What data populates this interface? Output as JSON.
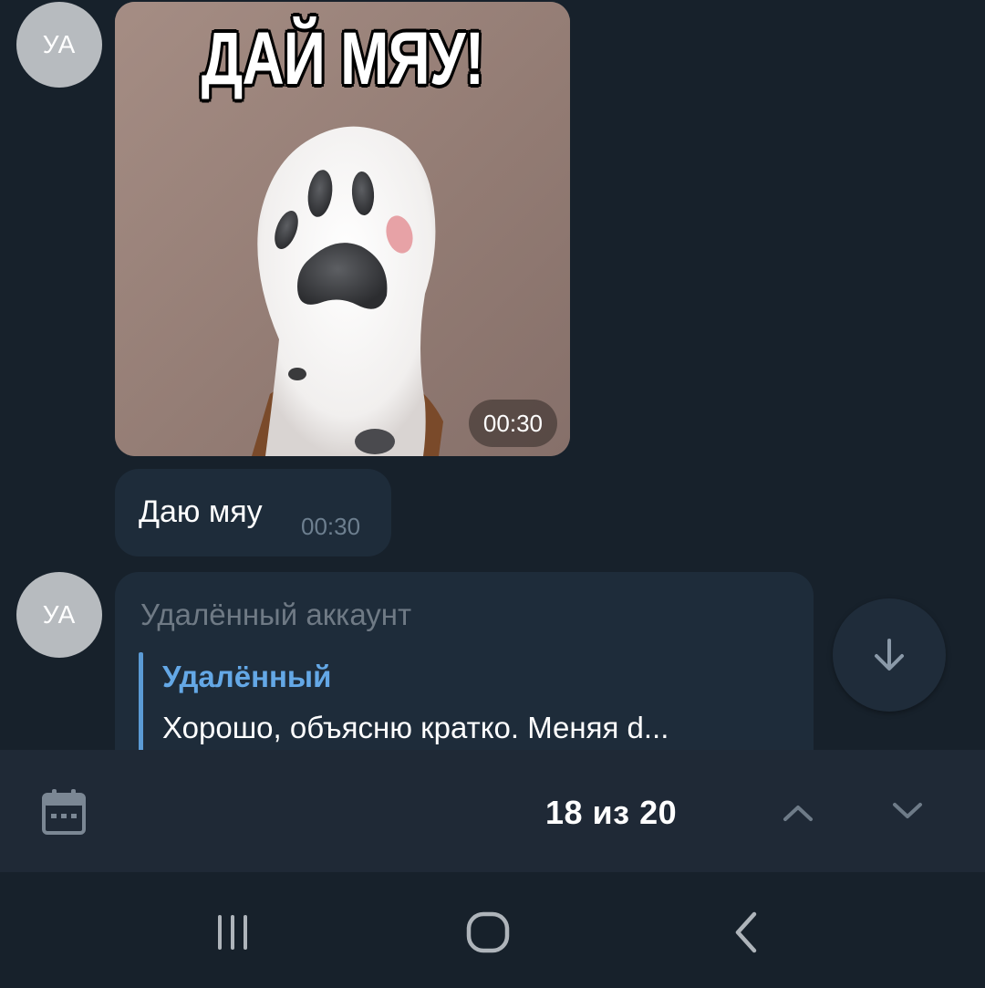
{
  "chat": {
    "messages": [
      {
        "type": "media",
        "avatar_initials": "УА",
        "image_text": "ДАЙ МЯУ!",
        "time": "00:30"
      },
      {
        "type": "text",
        "text": "Даю мяу",
        "time": "00:30"
      },
      {
        "type": "reply",
        "avatar_initials": "УА",
        "sender": "Удалённый аккаунт",
        "quote_author": "Удалённый",
        "quote_text": "Хорошо, объясню кратко. Меняя d..."
      }
    ],
    "scroll_down_icon": "arrow-down-icon"
  },
  "search_nav": {
    "calendar_icon": "calendar-icon",
    "counter": "18 из 20",
    "up_icon": "chevron-up-icon",
    "down_icon": "chevron-down-icon"
  },
  "system_nav": {
    "recents_icon": "recents-icon",
    "home_icon": "home-icon",
    "back_icon": "back-icon"
  },
  "colors": {
    "background": "#17212b",
    "bubble": "#1e2c3a",
    "accent": "#64a8e6",
    "search_bar": "#1f2936"
  }
}
